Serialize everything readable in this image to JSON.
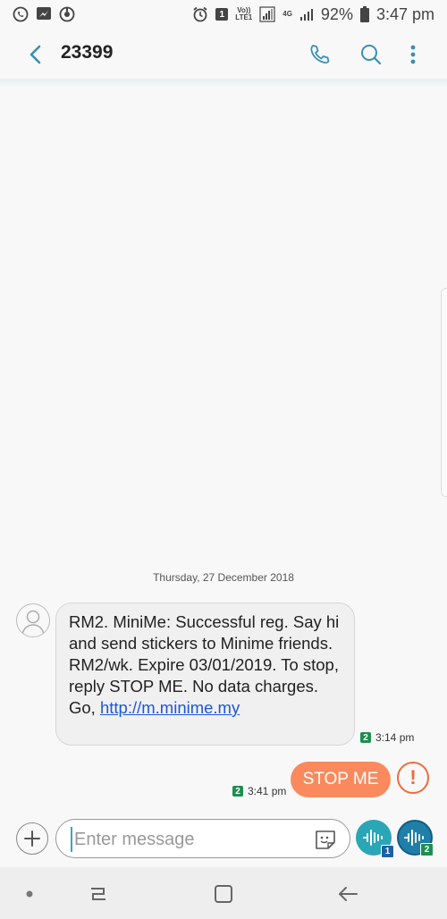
{
  "status_bar": {
    "battery": "92%",
    "time": "3:47 pm",
    "notification_count": "1",
    "volte_label": "Vo))",
    "lte_label": "LTE1",
    "network_label": "4G",
    "icons": [
      "whatsapp-icon",
      "messenger-icon",
      "sync-icon",
      "alarm-icon",
      "signal-icon",
      "battery-icon"
    ]
  },
  "header": {
    "title": "23399",
    "icons": [
      "back-icon",
      "phone-icon",
      "search-icon",
      "more-icon"
    ]
  },
  "conversation": {
    "date": "Thursday, 27 December 2018",
    "incoming": {
      "text": "RM2. MiniMe: Successful reg. Say hi and send stickers to Minime friends. RM2/wk. Expire 03/01/2019. To stop, reply STOP ME. No data charges. Go, ",
      "link": "http://m.minime.my",
      "time": "3:14 pm",
      "sim": "2"
    },
    "outgoing": {
      "text": "STOP ME",
      "time": "3:41 pm",
      "sim": "2",
      "status_icon": "!"
    }
  },
  "composer": {
    "placeholder": "Enter message",
    "send_sim_1": "1",
    "send_sim_2": "2"
  },
  "colors": {
    "accent": "#2aa6b6",
    "outgoing_bubble": "#fa8a5e",
    "error": "#f26a3a",
    "link": "#1c57d8",
    "sim_badge": "#1d8f4e"
  },
  "nav_bar": {
    "icons": [
      "home-dot-icon",
      "recents-icon",
      "home-icon",
      "back-nav-icon"
    ]
  }
}
